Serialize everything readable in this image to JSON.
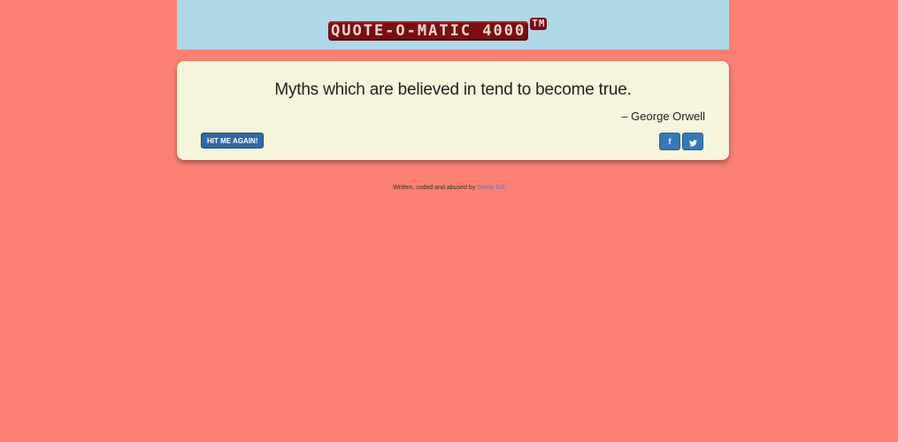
{
  "header": {
    "logo_text": "QUOTE-O-MATIC 4000",
    "logo_tm": "TM",
    "background_color": "#add8e6"
  },
  "quote": {
    "text": "Myths which are believed in tend to become true.",
    "author": "– George Orwell"
  },
  "actions": {
    "new_quote_label": "HIT ME AGAIN!",
    "facebook_icon": "facebook-icon",
    "twitter_icon": "twitter-icon",
    "button_color": "#337ab7"
  },
  "footer": {
    "text": "Written, coded and abused by",
    "author_link": "Stevie Gill"
  },
  "colors": {
    "page_background": "#fa8072",
    "card_background": "#f5f5dc"
  }
}
